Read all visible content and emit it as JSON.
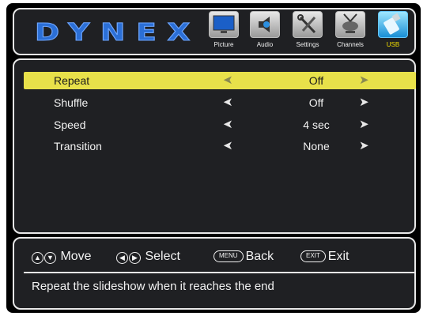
{
  "brand": "DYNEX",
  "tabs": [
    {
      "label": "Picture",
      "icon": "tv-icon"
    },
    {
      "label": "Audio",
      "icon": "speaker-icon"
    },
    {
      "label": "Settings",
      "icon": "tools-icon"
    },
    {
      "label": "Channels",
      "icon": "antenna-icon"
    },
    {
      "label": "USB",
      "icon": "usb-drive-icon",
      "active": true
    }
  ],
  "menu": [
    {
      "name": "Repeat",
      "value": "Off",
      "selected": true
    },
    {
      "name": "Shuffle",
      "value": "Off"
    },
    {
      "name": "Speed",
      "value": "4 sec"
    },
    {
      "name": "Transition",
      "value": "None"
    }
  ],
  "footer": {
    "move": "Move",
    "select": "Select",
    "menu_key": "MENU",
    "back": "Back",
    "exit_key": "EXIT",
    "exit": "Exit",
    "description": "Repeat the slideshow when it reaches the end"
  },
  "colors": {
    "highlight": "#e8e14a",
    "active_tab_label": "#f5e000",
    "brand_blue": "#2b6fd6"
  }
}
